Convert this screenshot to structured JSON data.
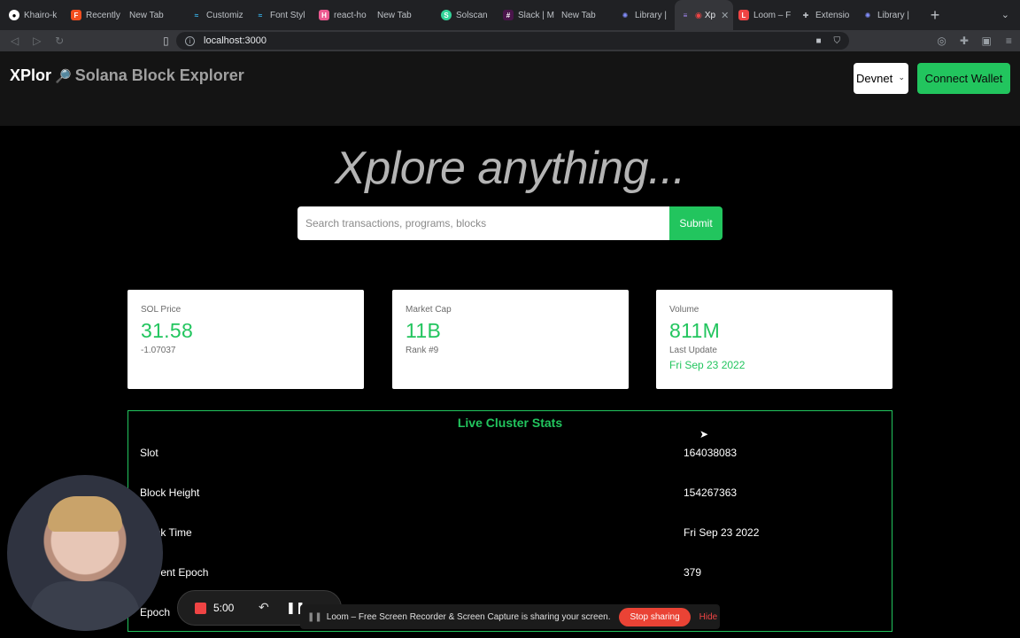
{
  "browser": {
    "tabs": [
      {
        "label": "Khairo-k",
        "icon": "github-icon",
        "color": "#ffffff"
      },
      {
        "label": "Recently",
        "icon": "figma-icon",
        "color": "#f24e1e"
      },
      {
        "label": "New Tab",
        "icon": "",
        "color": ""
      },
      {
        "label": "Customiz",
        "icon": "tailwind-icon",
        "color": "#38bdf8"
      },
      {
        "label": "Font Styl",
        "icon": "tailwind-icon",
        "color": "#38bdf8"
      },
      {
        "label": "react-ho",
        "icon": "react-hook-form-icon",
        "color": "#ec5990"
      },
      {
        "label": "New Tab",
        "icon": "",
        "color": ""
      },
      {
        "label": "Solscan",
        "icon": "solscan-icon",
        "color": "#34d399"
      },
      {
        "label": "Slack | M",
        "icon": "slack-icon",
        "color": "#e01e5a"
      },
      {
        "label": "New Tab",
        "icon": "",
        "color": ""
      },
      {
        "label": "Library |",
        "icon": "library-icon",
        "color": "#818cf8"
      },
      {
        "label": "Xp",
        "icon": "xplor-icon",
        "color": "#a78bfa",
        "active": true
      },
      {
        "label": "Loom – F",
        "icon": "loom-icon",
        "color": "#ef4444"
      },
      {
        "label": "Extensio",
        "icon": "puzzle-icon",
        "color": "#bdc1c6"
      },
      {
        "label": "Library |",
        "icon": "library-icon",
        "color": "#818cf8"
      }
    ],
    "url": "localhost:3000"
  },
  "header": {
    "brand": "XPlor",
    "brand_icon": "magnifier-icon",
    "subtitle": "Solana Block Explorer",
    "network": "Devnet",
    "connect_label": "Connect Wallet"
  },
  "hero": {
    "title": "Xplore anything...",
    "search_placeholder": "Search transactions, programs, blocks",
    "submit_label": "Submit"
  },
  "cards": [
    {
      "label": "SOL Price",
      "value": "31.58",
      "sub": "-1.07037"
    },
    {
      "label": "Market Cap",
      "value": "11B",
      "sub": "Rank #9"
    },
    {
      "label": "Volume",
      "value": "811M",
      "sub": "Last Update",
      "date": "Fri Sep 23 2022"
    }
  ],
  "cluster": {
    "title": "Live Cluster Stats",
    "rows": [
      {
        "key": "Slot",
        "value": "164038083"
      },
      {
        "key": "Block Height",
        "value": "154267363"
      },
      {
        "key": "Block Time",
        "value": "Fri Sep 23 2022"
      },
      {
        "key": "Current Epoch",
        "value": "379"
      },
      {
        "key": "Epoch",
        "value": ""
      }
    ]
  },
  "colors": {
    "accent": "#22c55e",
    "background": "#000000",
    "header_bg": "#141414",
    "card_bg": "#ffffff"
  },
  "loom": {
    "timer": "5:00",
    "sharing_message": "Loom – Free Screen Recorder & Screen Capture is sharing your screen.",
    "stop_label": "Stop sharing",
    "hide_label": "Hide"
  }
}
